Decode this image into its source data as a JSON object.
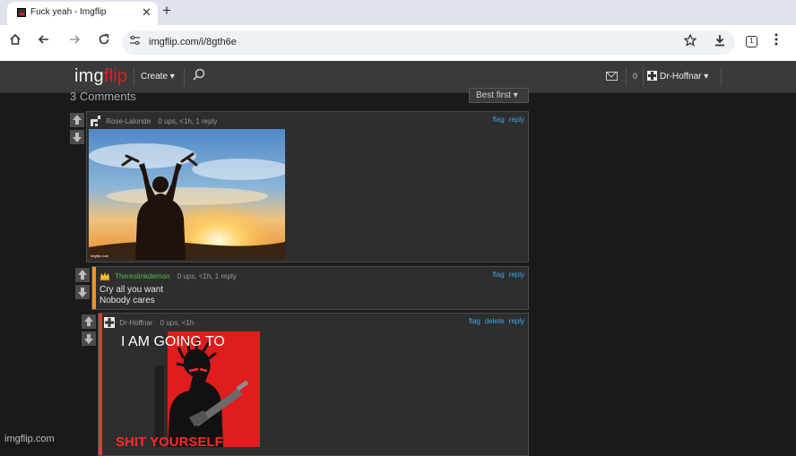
{
  "browser": {
    "tab_title": "Fuck yeah - Imgflip",
    "tab_close": "✕",
    "new_tab": "+",
    "url": "imgflip.com/i/8gth6e",
    "tab_count": "1",
    "icons": [
      "home-icon",
      "back-icon",
      "forward-icon",
      "reload-icon",
      "tune-icon",
      "star-icon",
      "download-icon",
      "menu-icon"
    ]
  },
  "site": {
    "logo_a": "img",
    "logo_b": "flip",
    "create_label": "Create ▾",
    "notif_count": "0",
    "username": "Dr-Hoffnar ▾"
  },
  "comments_header": {
    "count_label": "3 Comments",
    "sort_label": "Best first ▾"
  },
  "comments": [
    {
      "user": "Rose-Lalonde",
      "meta": "0 ups, <1h, 1 reply",
      "actions": [
        "flag",
        "reply"
      ],
      "image_caption": "imgflip.com"
    },
    {
      "user": "Thereslinkdemon",
      "meta": "0 ups, <1h, 1 reply",
      "actions": [
        "flag",
        "reply"
      ],
      "text_line1": "Cry all you want",
      "text_line2": "Nobody cares"
    },
    {
      "user": "Dr-Hoffnar",
      "meta": "0 ups, <1h",
      "actions": [
        "flag",
        "delete",
        "reply"
      ],
      "meme_top": "I AM GOING TO",
      "meme_bottom": "SHIT YOURSELF"
    }
  ],
  "watermark": "imgflip.com",
  "colors": {
    "accent_red": "#e0201f",
    "link_blue": "#3aa7ea",
    "orange_stripe": "#e8962a",
    "red_stripe": "#d93b3b",
    "username_green": "#4cbf4c"
  }
}
